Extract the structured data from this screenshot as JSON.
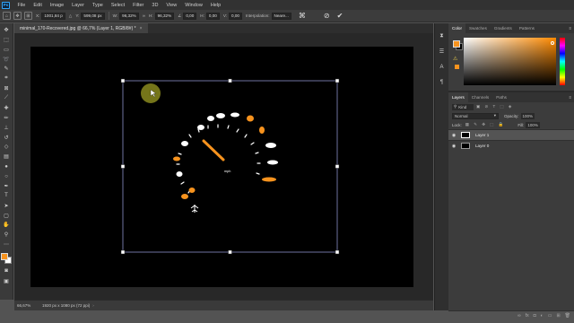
{
  "menubar": {
    "logo": "Ps",
    "items": [
      "File",
      "Edit",
      "Image",
      "Layer",
      "Type",
      "Select",
      "Filter",
      "3D",
      "View",
      "Window",
      "Help"
    ]
  },
  "options": {
    "x": "1001,84 p",
    "y": "599,08 px",
    "w": "96,32%",
    "h": "96,32%",
    "angle": "0,00",
    "h_skew": "0,00",
    "v_skew": "0,00",
    "interpolation_label": "Interpolation:",
    "interpolation_value": "Neare..."
  },
  "document": {
    "tab_title": "minimal_170-Recovered.jpg @ 66,7% (Layer 1, RGB/8#) *"
  },
  "status": {
    "zoom": "66,67%",
    "info": "1920 px x 1080 px (72 ppi)"
  },
  "color_panel": {
    "tabs": [
      "Color",
      "Swatches",
      "Gradients",
      "Patterns"
    ],
    "foreground": "#f7931e",
    "background": "#000000"
  },
  "layers_panel": {
    "tabs": [
      "Layers",
      "Channels",
      "Paths"
    ],
    "kind": "Kind",
    "blend_mode": "Normal",
    "opacity_label": "Opacity:",
    "opacity_value": "100%",
    "lock_label": "Lock:",
    "fill_label": "Fill:",
    "fill_value": "100%",
    "layers": [
      {
        "name": "Layer 1",
        "selected": true
      },
      {
        "name": "Layer 0",
        "selected": false
      }
    ]
  },
  "artwork": {
    "gauge_label": "mph",
    "accent": "#f7931e"
  }
}
